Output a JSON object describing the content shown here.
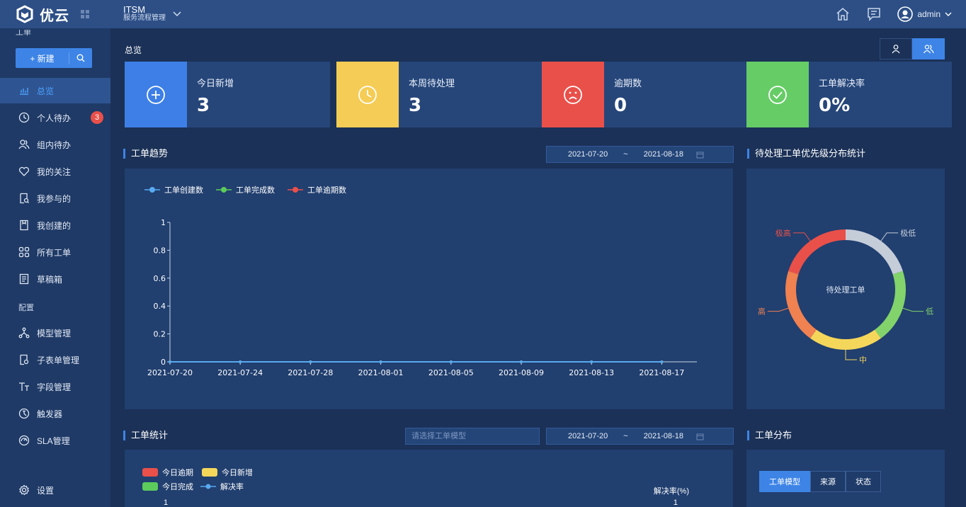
{
  "header": {
    "logo_text": "优云",
    "product_title": "ITSM",
    "product_subtitle": "服务流程管理",
    "user_name": "admin"
  },
  "sidebar": {
    "group_top": "工单",
    "new_label": "+ 新建",
    "items": [
      {
        "label": "总览",
        "icon": "bar-chart-icon",
        "active": true
      },
      {
        "label": "个人待办",
        "icon": "clock-icon",
        "badge": "3"
      },
      {
        "label": "组内待办",
        "icon": "group-icon"
      },
      {
        "label": "我的关注",
        "icon": "heart-icon"
      },
      {
        "label": "我参与的",
        "icon": "document-search-icon"
      },
      {
        "label": "我创建的",
        "icon": "document-icon"
      },
      {
        "label": "所有工单",
        "icon": "grid-icon"
      },
      {
        "label": "草稿箱",
        "icon": "draft-icon"
      }
    ],
    "config_section": "配置",
    "config_items": [
      {
        "label": "模型管理",
        "icon": "model-icon"
      },
      {
        "label": "子表单管理",
        "icon": "subform-icon"
      },
      {
        "label": "字段管理",
        "icon": "field-icon"
      },
      {
        "label": "触发器",
        "icon": "trigger-icon"
      },
      {
        "label": "SLA管理",
        "icon": "sla-icon"
      }
    ],
    "settings_label": "设置"
  },
  "main": {
    "breadcrumb": "总览",
    "cards": [
      {
        "label": "今日新增",
        "value": "3",
        "color": "#3d7fe6",
        "icon": "plus-circle-icon"
      },
      {
        "label": "本周待处理",
        "value": "3",
        "color": "#f5cc55",
        "icon": "clock-icon"
      },
      {
        "label": "逾期数",
        "value": "0",
        "color": "#e9504a",
        "icon": "sad-face-icon"
      },
      {
        "label": "工单解决率",
        "value": "0%",
        "color": "#66cc66",
        "icon": "check-circle-icon"
      }
    ],
    "trend": {
      "title": "工单趋势",
      "date_start": "2021-07-20",
      "date_sep": "~",
      "date_end": "2021-08-18"
    },
    "priority": {
      "title": "待处理工单优先级分布统计",
      "center_label": "待处理工单",
      "labels": {
        "very_high": "极高",
        "very_low": "极低",
        "high": "高",
        "low": "低",
        "mid": "中"
      }
    },
    "stats": {
      "title": "工单统计",
      "model_placeholder": "请选择工单模型",
      "date_start": "2021-07-20",
      "date_sep": "~",
      "date_end": "2021-08-18",
      "legend": [
        "今日逾期",
        "今日新增",
        "今日完成",
        "解决率"
      ],
      "right_axis_label": "解决率(%)",
      "left_axis_top": "1",
      "right_axis_top": "1"
    },
    "distribution": {
      "title": "工单分布",
      "tabs": [
        "工单模型",
        "来源",
        "状态"
      ]
    }
  },
  "chart_data": [
    {
      "type": "line",
      "x": [
        "2021-07-20",
        "2021-07-24",
        "2021-07-28",
        "2021-08-01",
        "2021-08-05",
        "2021-08-09",
        "2021-08-13",
        "2021-08-17"
      ],
      "series": [
        {
          "name": "工单创建数",
          "color": "#59a9f0",
          "values": [
            0,
            0,
            0,
            0,
            0,
            0,
            0,
            0
          ]
        },
        {
          "name": "工单完成数",
          "color": "#5ccb5c",
          "values": [
            0,
            0,
            0,
            0,
            0,
            0,
            0,
            0
          ]
        },
        {
          "name": "工单逾期数",
          "color": "#e9504a",
          "values": [
            0,
            0,
            0,
            0,
            0,
            0,
            0,
            0
          ]
        }
      ],
      "ylim": [
        0,
        1
      ],
      "yticks": [
        "0",
        "0.2",
        "0.4",
        "0.6",
        "0.8",
        "1"
      ],
      "legend_position": "top-left"
    },
    {
      "type": "pie",
      "style": "donut",
      "slices": [
        {
          "label": "极低",
          "color": "#c5cdd9",
          "value": 1
        },
        {
          "label": "低",
          "color": "#82d36b",
          "value": 1
        },
        {
          "label": "中",
          "color": "#f4d65a",
          "value": 1
        },
        {
          "label": "高",
          "color": "#f08150",
          "value": 1
        },
        {
          "label": "极高",
          "color": "#e9504a",
          "value": 1
        }
      ]
    }
  ]
}
